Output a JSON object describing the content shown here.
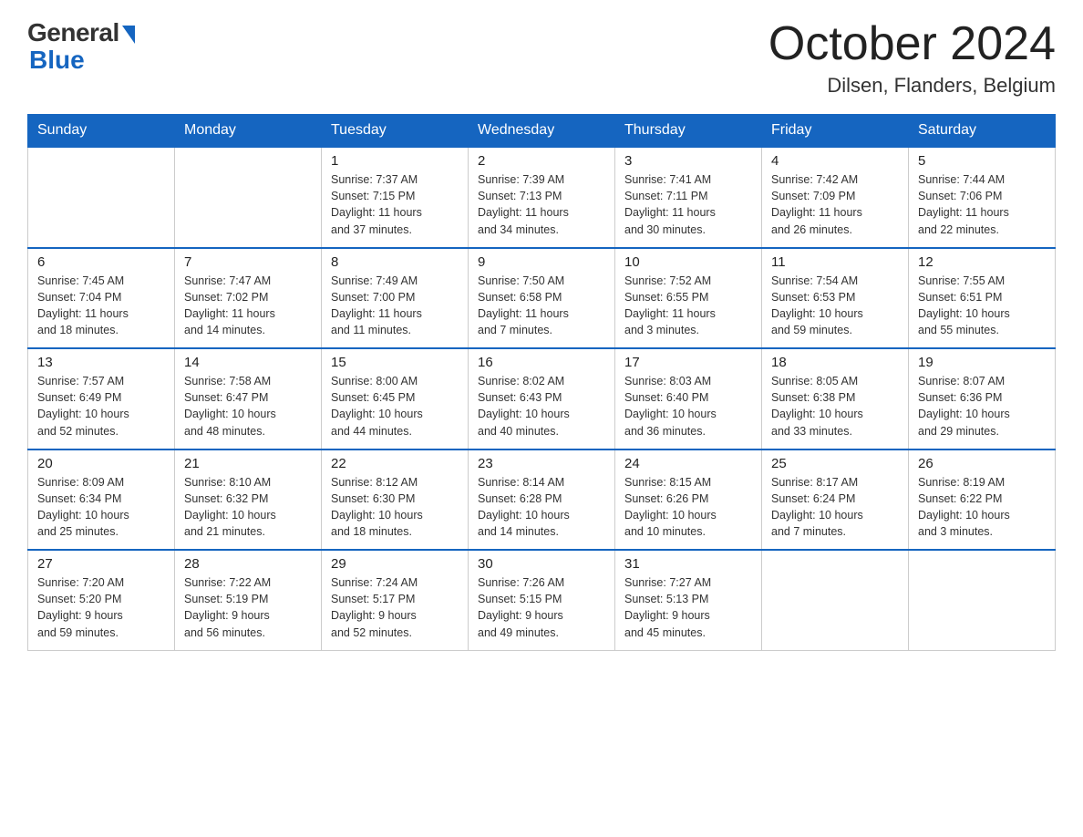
{
  "header": {
    "logo_general": "General",
    "logo_blue": "Blue",
    "month_title": "October 2024",
    "location": "Dilsen, Flanders, Belgium"
  },
  "days_of_week": [
    "Sunday",
    "Monday",
    "Tuesday",
    "Wednesday",
    "Thursday",
    "Friday",
    "Saturday"
  ],
  "weeks": [
    [
      {
        "num": "",
        "info": ""
      },
      {
        "num": "",
        "info": ""
      },
      {
        "num": "1",
        "info": "Sunrise: 7:37 AM\nSunset: 7:15 PM\nDaylight: 11 hours\nand 37 minutes."
      },
      {
        "num": "2",
        "info": "Sunrise: 7:39 AM\nSunset: 7:13 PM\nDaylight: 11 hours\nand 34 minutes."
      },
      {
        "num": "3",
        "info": "Sunrise: 7:41 AM\nSunset: 7:11 PM\nDaylight: 11 hours\nand 30 minutes."
      },
      {
        "num": "4",
        "info": "Sunrise: 7:42 AM\nSunset: 7:09 PM\nDaylight: 11 hours\nand 26 minutes."
      },
      {
        "num": "5",
        "info": "Sunrise: 7:44 AM\nSunset: 7:06 PM\nDaylight: 11 hours\nand 22 minutes."
      }
    ],
    [
      {
        "num": "6",
        "info": "Sunrise: 7:45 AM\nSunset: 7:04 PM\nDaylight: 11 hours\nand 18 minutes."
      },
      {
        "num": "7",
        "info": "Sunrise: 7:47 AM\nSunset: 7:02 PM\nDaylight: 11 hours\nand 14 minutes."
      },
      {
        "num": "8",
        "info": "Sunrise: 7:49 AM\nSunset: 7:00 PM\nDaylight: 11 hours\nand 11 minutes."
      },
      {
        "num": "9",
        "info": "Sunrise: 7:50 AM\nSunset: 6:58 PM\nDaylight: 11 hours\nand 7 minutes."
      },
      {
        "num": "10",
        "info": "Sunrise: 7:52 AM\nSunset: 6:55 PM\nDaylight: 11 hours\nand 3 minutes."
      },
      {
        "num": "11",
        "info": "Sunrise: 7:54 AM\nSunset: 6:53 PM\nDaylight: 10 hours\nand 59 minutes."
      },
      {
        "num": "12",
        "info": "Sunrise: 7:55 AM\nSunset: 6:51 PM\nDaylight: 10 hours\nand 55 minutes."
      }
    ],
    [
      {
        "num": "13",
        "info": "Sunrise: 7:57 AM\nSunset: 6:49 PM\nDaylight: 10 hours\nand 52 minutes."
      },
      {
        "num": "14",
        "info": "Sunrise: 7:58 AM\nSunset: 6:47 PM\nDaylight: 10 hours\nand 48 minutes."
      },
      {
        "num": "15",
        "info": "Sunrise: 8:00 AM\nSunset: 6:45 PM\nDaylight: 10 hours\nand 44 minutes."
      },
      {
        "num": "16",
        "info": "Sunrise: 8:02 AM\nSunset: 6:43 PM\nDaylight: 10 hours\nand 40 minutes."
      },
      {
        "num": "17",
        "info": "Sunrise: 8:03 AM\nSunset: 6:40 PM\nDaylight: 10 hours\nand 36 minutes."
      },
      {
        "num": "18",
        "info": "Sunrise: 8:05 AM\nSunset: 6:38 PM\nDaylight: 10 hours\nand 33 minutes."
      },
      {
        "num": "19",
        "info": "Sunrise: 8:07 AM\nSunset: 6:36 PM\nDaylight: 10 hours\nand 29 minutes."
      }
    ],
    [
      {
        "num": "20",
        "info": "Sunrise: 8:09 AM\nSunset: 6:34 PM\nDaylight: 10 hours\nand 25 minutes."
      },
      {
        "num": "21",
        "info": "Sunrise: 8:10 AM\nSunset: 6:32 PM\nDaylight: 10 hours\nand 21 minutes."
      },
      {
        "num": "22",
        "info": "Sunrise: 8:12 AM\nSunset: 6:30 PM\nDaylight: 10 hours\nand 18 minutes."
      },
      {
        "num": "23",
        "info": "Sunrise: 8:14 AM\nSunset: 6:28 PM\nDaylight: 10 hours\nand 14 minutes."
      },
      {
        "num": "24",
        "info": "Sunrise: 8:15 AM\nSunset: 6:26 PM\nDaylight: 10 hours\nand 10 minutes."
      },
      {
        "num": "25",
        "info": "Sunrise: 8:17 AM\nSunset: 6:24 PM\nDaylight: 10 hours\nand 7 minutes."
      },
      {
        "num": "26",
        "info": "Sunrise: 8:19 AM\nSunset: 6:22 PM\nDaylight: 10 hours\nand 3 minutes."
      }
    ],
    [
      {
        "num": "27",
        "info": "Sunrise: 7:20 AM\nSunset: 5:20 PM\nDaylight: 9 hours\nand 59 minutes."
      },
      {
        "num": "28",
        "info": "Sunrise: 7:22 AM\nSunset: 5:19 PM\nDaylight: 9 hours\nand 56 minutes."
      },
      {
        "num": "29",
        "info": "Sunrise: 7:24 AM\nSunset: 5:17 PM\nDaylight: 9 hours\nand 52 minutes."
      },
      {
        "num": "30",
        "info": "Sunrise: 7:26 AM\nSunset: 5:15 PM\nDaylight: 9 hours\nand 49 minutes."
      },
      {
        "num": "31",
        "info": "Sunrise: 7:27 AM\nSunset: 5:13 PM\nDaylight: 9 hours\nand 45 minutes."
      },
      {
        "num": "",
        "info": ""
      },
      {
        "num": "",
        "info": ""
      }
    ]
  ]
}
